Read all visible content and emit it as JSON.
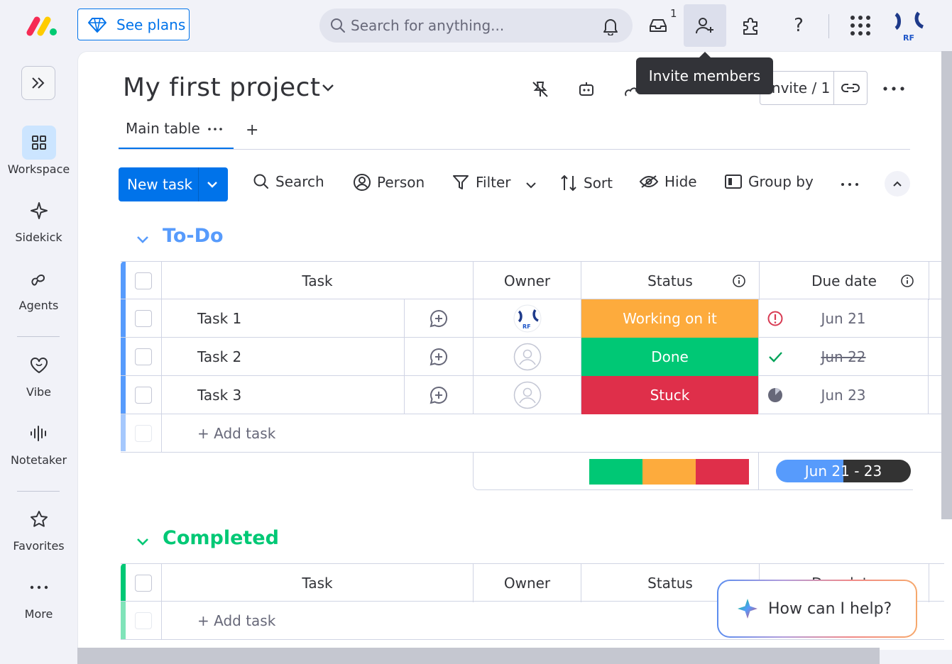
{
  "topbar": {
    "see_plans": "See plans",
    "search_placeholder": "Search for anything...",
    "inbox_badge": "1",
    "tooltip": "Invite members",
    "user_initials": "RF"
  },
  "sidebar": {
    "items": [
      {
        "label": "Workspace",
        "icon": "grid-icon"
      },
      {
        "label": "Sidekick",
        "icon": "sparkle-icon"
      },
      {
        "label": "Agents",
        "icon": "agents-icon"
      },
      {
        "label": "Vibe",
        "icon": "heart-icon"
      },
      {
        "label": "Notetaker",
        "icon": "waveform-icon"
      },
      {
        "label": "Favorites",
        "icon": "star-icon"
      },
      {
        "label": "More",
        "icon": "more-dots-icon"
      }
    ]
  },
  "board": {
    "title": "My first project",
    "tab": "Main table",
    "invite_label": "Invite / 1",
    "toolbar": {
      "new_task": "New task",
      "search": "Search",
      "person": "Person",
      "filter": "Filter",
      "sort": "Sort",
      "hide": "Hide",
      "group_by": "Group by"
    },
    "groups": [
      {
        "title": "To-Do",
        "color": "#579bfc",
        "columns": {
          "task": "Task",
          "owner": "Owner",
          "status": "Status",
          "due": "Due date"
        },
        "rows": [
          {
            "task": "Task 1",
            "status": "Working on it",
            "status_color": "#fdab3d",
            "due": "Jun 21"
          },
          {
            "task": "Task 2",
            "status": "Done",
            "status_color": "#00c875",
            "due": "Jun 22"
          },
          {
            "task": "Task 3",
            "status": "Stuck",
            "status_color": "#df2f4a",
            "due": "Jun 23"
          }
        ],
        "add_task": "+ Add task",
        "timeline_summary": "Jun 21 - 23"
      },
      {
        "title": "Completed",
        "color": "#00c875",
        "columns": {
          "task": "Task",
          "owner": "Owner",
          "status": "Status",
          "due": "Due date"
        },
        "add_task": "+ Add task"
      }
    ]
  },
  "assistant": {
    "prompt": "How can I help?"
  }
}
